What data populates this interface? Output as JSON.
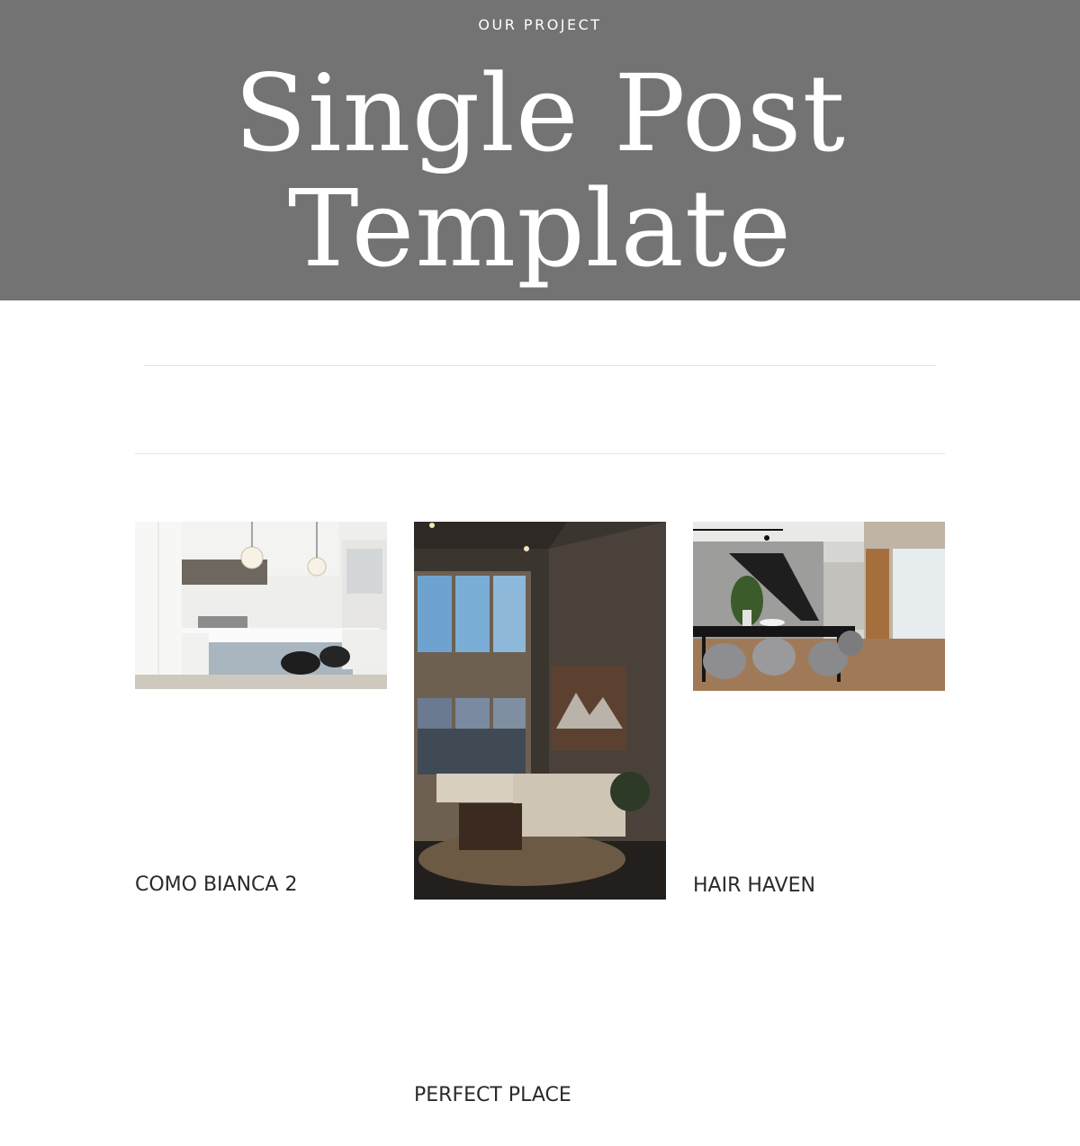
{
  "hero": {
    "eyebrow": "OUR PROJECT",
    "title_line_1": "Single Post",
    "title_line_2": "Template",
    "background": "#737373"
  },
  "projects": [
    {
      "title": "COMO BIANCA 2",
      "image": "white-kitchen-photo"
    },
    {
      "title": "PERFECT PLACE",
      "image": "living-room-photo"
    },
    {
      "title": "HAIR HAVEN",
      "image": "dining-room-photo"
    }
  ]
}
